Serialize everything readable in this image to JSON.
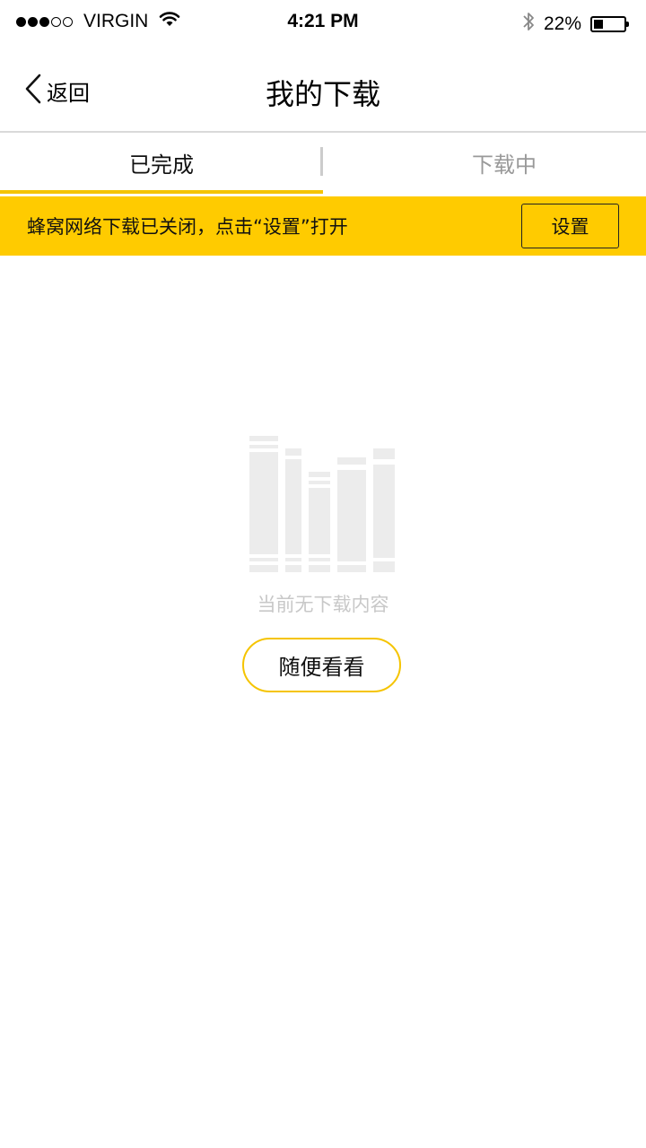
{
  "status_bar": {
    "signal_full": 3,
    "signal_total": 5,
    "carrier": "VIRGIN",
    "time": "4:21 PM",
    "battery_percent": "22%",
    "battery_level": 0.22,
    "icons": [
      "wifi-icon",
      "bluetooth-icon",
      "battery-icon"
    ]
  },
  "nav": {
    "back_label": "返回",
    "title": "我的下载",
    "back_icon": "chevron-left-icon"
  },
  "tabs": [
    {
      "label": "已完成",
      "active": true
    },
    {
      "label": "下载中",
      "active": false
    }
  ],
  "notice": {
    "text": "蜂窝网络下载已关闭，点击“设置”打开",
    "button_label": "设置"
  },
  "empty_state": {
    "icon": "empty-books-icon",
    "message": "当前无下载内容",
    "button_label": "随便看看"
  },
  "colors": {
    "accent": "#ffcb00",
    "indicator": "#f5c400",
    "muted_text": "#999999",
    "empty_text": "#c8c8c8",
    "illustration": "#ececec"
  }
}
